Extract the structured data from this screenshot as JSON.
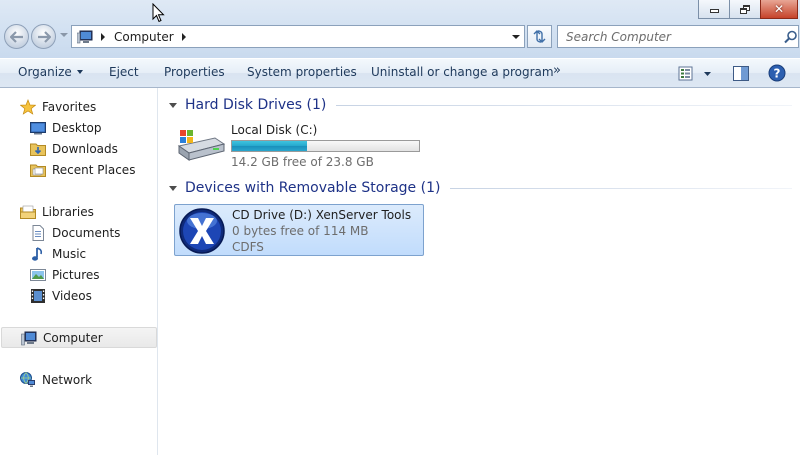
{
  "window": {
    "controls": {
      "minimize_icon": "minimize-icon",
      "maximize_icon": "restore-icon",
      "close_icon": "close-icon"
    }
  },
  "address_bar": {
    "breadcrumbs": [
      "Computer"
    ],
    "search_placeholder": "Search Computer"
  },
  "toolbar": {
    "items": {
      "organize": "Organize",
      "eject": "Eject",
      "properties": "Properties",
      "system_properties": "System properties",
      "uninstall": "Uninstall or change a program",
      "more": "»"
    }
  },
  "nav_pane": {
    "favorites": {
      "label": "Favorites",
      "items": [
        "Desktop",
        "Downloads",
        "Recent Places"
      ]
    },
    "libraries": {
      "label": "Libraries",
      "items": [
        "Documents",
        "Music",
        "Pictures",
        "Videos"
      ]
    },
    "computer": "Computer",
    "network": "Network"
  },
  "content": {
    "groups": [
      {
        "title": "Hard Disk Drives (1)",
        "drives": [
          {
            "name": "Local Disk (C:)",
            "free_text": "14.2 GB free of 23.8 GB",
            "used_fraction": 0.403
          }
        ]
      },
      {
        "title": "Devices with Removable Storage (1)",
        "drives": [
          {
            "name": "CD Drive (D:) XenServer Tools",
            "free_text": "0 bytes free of 114 MB",
            "filesystem": "CDFS"
          }
        ]
      }
    ]
  },
  "colors": {
    "group_title": "#1e3287",
    "selection": "#c1dcfc",
    "progress_fill": "#26a7cc"
  }
}
